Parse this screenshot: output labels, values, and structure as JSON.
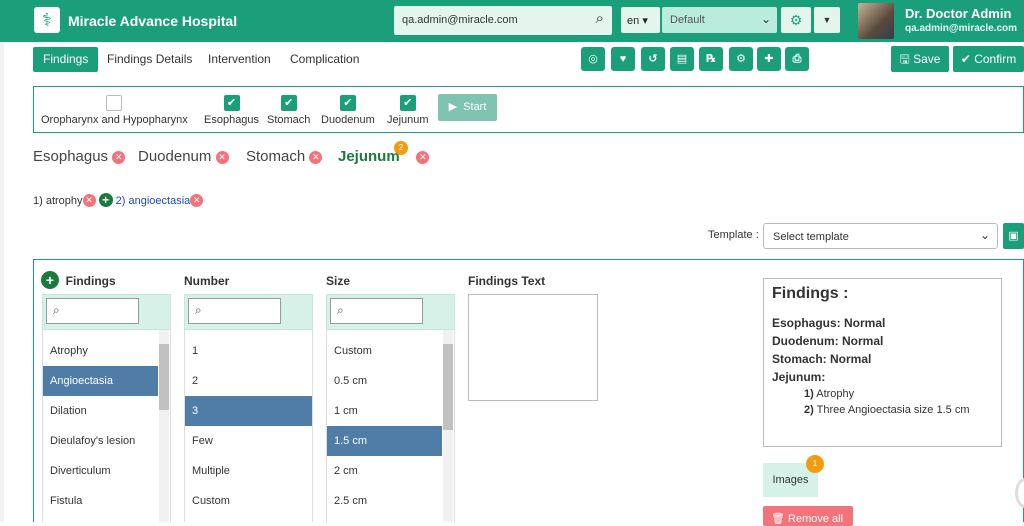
{
  "header": {
    "brand": "Miracle Advance Hospital",
    "search_value": "qa.admin@miracle.com",
    "language": "en",
    "department": "Default",
    "user_name": "Dr. Doctor Admin",
    "user_email": "qa.admin@miracle.com"
  },
  "tabs": [
    "Findings",
    "Findings Details",
    "Intervention",
    "Complication"
  ],
  "toolbar": {
    "save_label": "Save",
    "confirm_label": "Confirm"
  },
  "organs": {
    "items": [
      {
        "label": "Oropharynx and Hypopharynx",
        "checked": false
      },
      {
        "label": "Esophagus",
        "checked": true
      },
      {
        "label": "Stomach",
        "checked": true
      },
      {
        "label": "Duodenum",
        "checked": true
      },
      {
        "label": "Jejunum",
        "checked": true
      }
    ],
    "start_label": "Start"
  },
  "selected_organs": {
    "esophagus": "Esophagus",
    "duodenum": "Duodenum",
    "stomach": "Stomach",
    "jejunum": "Jejunum",
    "jejunum_count": "2"
  },
  "finding_entries": {
    "first": "1) atrophy",
    "second": "2) angioectasia"
  },
  "template": {
    "label": "Template :",
    "placeholder": "Select template"
  },
  "columns": {
    "findings": "Findings",
    "number": "Number",
    "size": "Size",
    "findings_text": "Findings Text"
  },
  "findings_list": [
    "Atrophy",
    "Angioectasia",
    "Dilation",
    "Dieulafoy's lesion",
    "Diverticulum",
    "Fistula"
  ],
  "number_list": [
    "1",
    "2",
    "3",
    "Few",
    "Multiple",
    "Custom"
  ],
  "size_list": [
    "Custom",
    "0.5 cm",
    "1 cm",
    "1.5 cm",
    "2 cm",
    "2.5 cm"
  ],
  "selected": {
    "finding": "Angioectasia",
    "number": "3",
    "size": "1.5 cm"
  },
  "summary": {
    "title": "Findings :",
    "esophagus": "Esophagus: Normal",
    "duodenum": "Duodenum: Normal",
    "stomach": "Stomach: Normal",
    "jejunum": "Jejunum:",
    "item1_num": "1)",
    "item1_text": "Atrophy",
    "item2_num": "2)",
    "item2_text": "Three Angioectasia size 1.5 cm"
  },
  "images": {
    "label": "Images",
    "count": "1"
  },
  "remove_all_label": "Remove all",
  "colors": {
    "accent": "#1b9e7a",
    "selected_row": "#4f7da8",
    "danger": "#f4727a",
    "badge": "#f39c12"
  }
}
